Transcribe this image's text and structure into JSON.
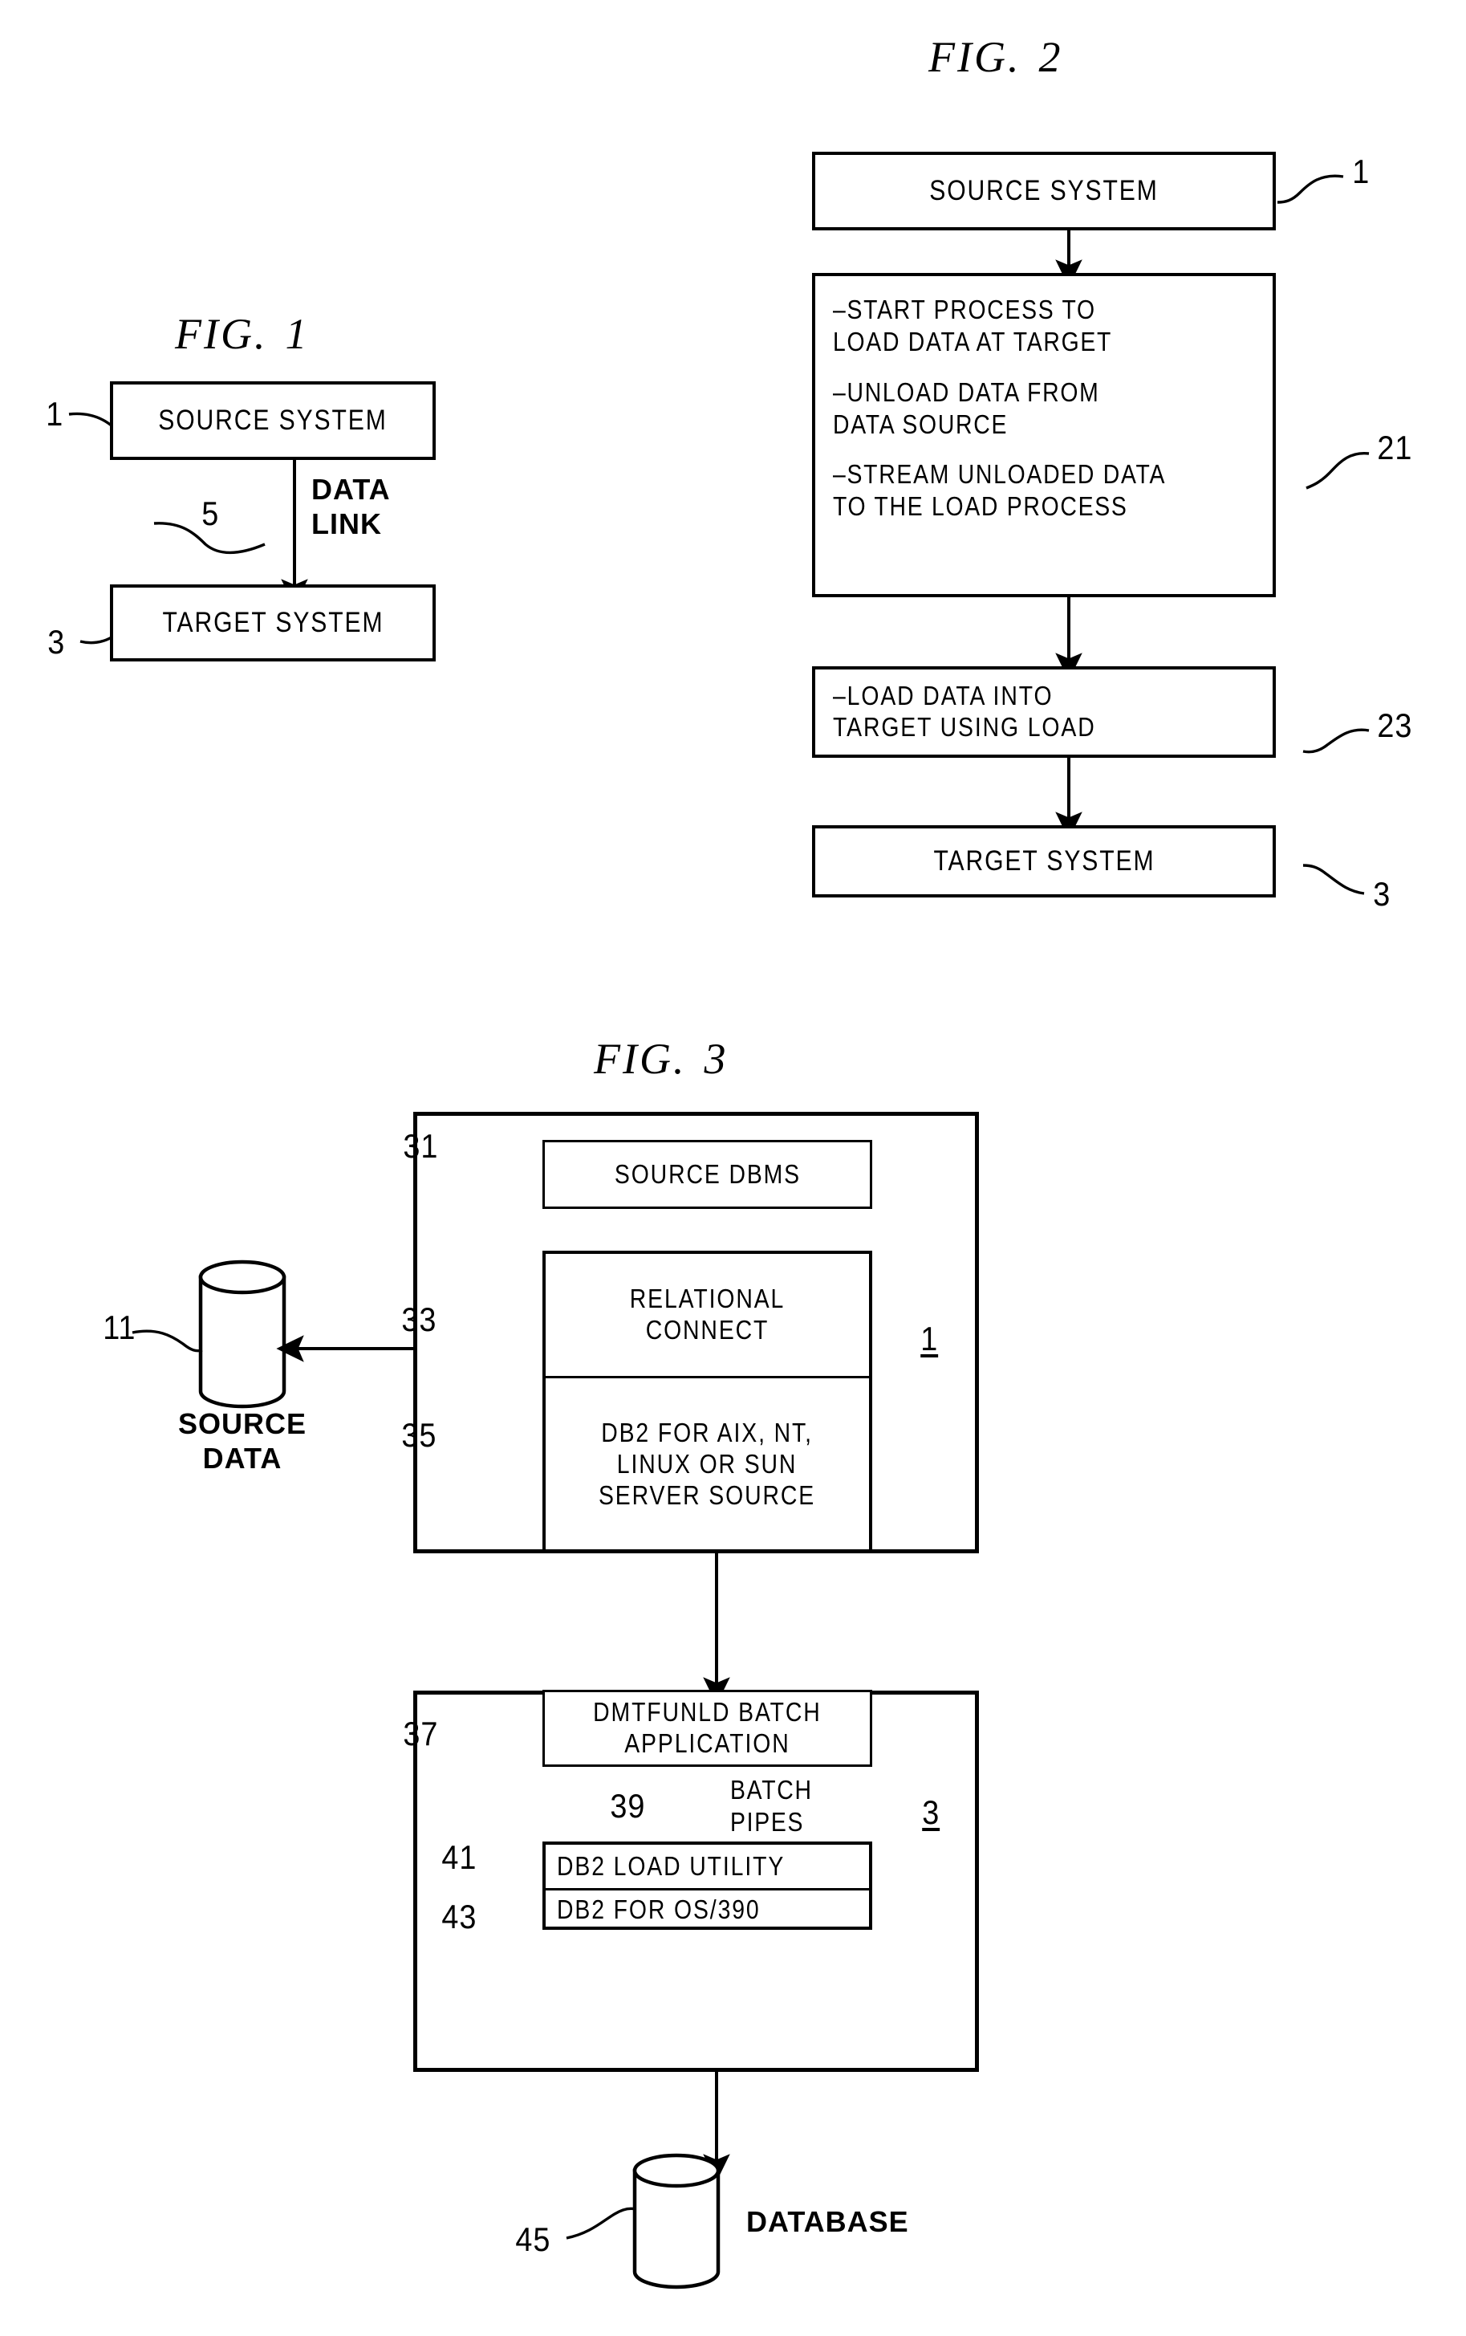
{
  "document": {
    "kind": "patent-drawing-sheet",
    "background": "#ffffff",
    "ink": "#000000"
  },
  "figures": [
    {
      "id": "fig1",
      "title_prefix": "FIG.",
      "title_number": "1",
      "boxes": [
        {
          "id": "f1-source-system",
          "label": "SOURCE SYSTEM",
          "ref": "1"
        },
        {
          "id": "f1-target-system",
          "label": "TARGET SYSTEM",
          "ref": "3"
        }
      ],
      "connector": {
        "id": "f1-data-link",
        "ref": "5",
        "label": "DATA\nLINK"
      }
    },
    {
      "id": "fig2",
      "title_prefix": "FIG.",
      "title_number": "2",
      "boxes": [
        {
          "id": "f2-source-system",
          "label": "SOURCE SYSTEM",
          "ref": "1"
        },
        {
          "id": "f2-process",
          "ref": "21",
          "lines": [
            "–START PROCESS TO\nLOAD DATA AT TARGET",
            "–UNLOAD DATA FROM\nDATA SOURCE",
            "–STREAM UNLOADED DATA\nTO THE LOAD PROCESS"
          ]
        },
        {
          "id": "f2-load",
          "label": "–LOAD DATA INTO\nTARGET USING LOAD",
          "ref": "23"
        },
        {
          "id": "f2-target-system",
          "label": "TARGET SYSTEM",
          "ref": "3"
        }
      ]
    },
    {
      "id": "fig3",
      "title_prefix": "FIG.",
      "title_number": "3",
      "source_container": {
        "id": "f3-source-container",
        "ref": "1",
        "boxes": [
          {
            "id": "f3-source-dbms",
            "label": "SOURCE DBMS",
            "ref": "31"
          },
          {
            "id": "f3-relational-connect",
            "label": "RELATIONAL\nCONNECT",
            "ref": "33"
          },
          {
            "id": "f3-db2-source",
            "label": "DB2 FOR AIX, NT,\nLINUX OR SUN\nSERVER SOURCE",
            "ref": "35"
          }
        ]
      },
      "target_container": {
        "id": "f3-target-container",
        "ref": "3",
        "boxes": [
          {
            "id": "f3-dmtfunld",
            "label": "DMTFUNLD BATCH\nAPPLICATION",
            "ref": "37"
          },
          {
            "id": "f3-db2-load-utility",
            "label": "DB2 LOAD UTILITY",
            "ref": "41"
          },
          {
            "id": "f3-db2-os390",
            "label": "DB2 FOR OS/390",
            "ref": "43"
          }
        ],
        "connector": {
          "id": "f3-batch-pipes",
          "ref": "39",
          "label": "BATCH\nPIPES"
        }
      },
      "cylinders": [
        {
          "id": "f3-source-data",
          "label": "SOURCE\nDATA",
          "ref": "11"
        },
        {
          "id": "f3-database",
          "label": "DATABASE",
          "ref": "45"
        }
      ]
    }
  ]
}
